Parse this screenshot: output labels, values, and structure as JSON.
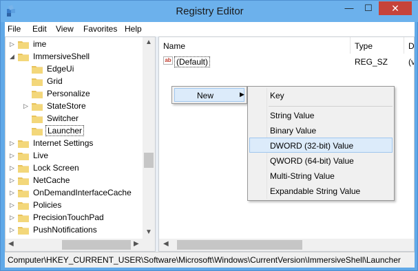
{
  "window": {
    "title": "Registry Editor",
    "close_glyph": "✕",
    "min_glyph": "—",
    "max_glyph": "☐"
  },
  "menubar": {
    "items": [
      "File",
      "Edit",
      "View",
      "Favorites",
      "Help"
    ]
  },
  "tree": {
    "items": [
      {
        "label": "ime",
        "level": 0,
        "expander": "▷"
      },
      {
        "label": "ImmersiveShell",
        "level": 0,
        "expander": "◢"
      },
      {
        "label": "EdgeUi",
        "level": 1,
        "expander": ""
      },
      {
        "label": "Grid",
        "level": 1,
        "expander": ""
      },
      {
        "label": "Personalize",
        "level": 1,
        "expander": ""
      },
      {
        "label": "StateStore",
        "level": 1,
        "expander": "▷"
      },
      {
        "label": "Switcher",
        "level": 1,
        "expander": ""
      },
      {
        "label": "Launcher",
        "level": 1,
        "expander": "",
        "selected": true
      },
      {
        "label": "Internet Settings",
        "level": 0,
        "expander": "▷"
      },
      {
        "label": "Live",
        "level": 0,
        "expander": "▷"
      },
      {
        "label": "Lock Screen",
        "level": 0,
        "expander": "▷"
      },
      {
        "label": "NetCache",
        "level": 0,
        "expander": "▷"
      },
      {
        "label": "OnDemandInterfaceCache",
        "level": 0,
        "expander": "▷"
      },
      {
        "label": "Policies",
        "level": 0,
        "expander": "▷"
      },
      {
        "label": "PrecisionTouchPad",
        "level": 0,
        "expander": "▷"
      },
      {
        "label": "PushNotifications",
        "level": 0,
        "expander": "▷"
      }
    ]
  },
  "list": {
    "columns": [
      "Name",
      "Type",
      "D"
    ],
    "rows": [
      {
        "name": "(Default)",
        "type": "REG_SZ",
        "data": "(v"
      }
    ]
  },
  "context_menu": {
    "new_label": "New",
    "submenu": [
      "Key",
      "String Value",
      "Binary Value",
      "DWORD (32-bit) Value",
      "QWORD (64-bit) Value",
      "Multi-String Value",
      "Expandable String Value"
    ],
    "highlighted": "DWORD (32-bit) Value"
  },
  "statusbar": {
    "path": "Computer\\HKEY_CURRENT_USER\\Software\\Microsoft\\Windows\\CurrentVersion\\ImmersiveShell\\Launcher"
  },
  "colors": {
    "titlebar": "#6cb1ec",
    "close": "#c6433a",
    "highlight": "#dcebfa",
    "folder": "#e8c25a"
  }
}
